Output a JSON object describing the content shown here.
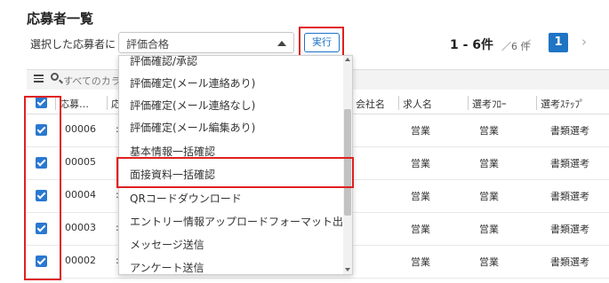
{
  "page": {
    "title": "応募者一覧"
  },
  "action_bar": {
    "label": "選択した応募者に",
    "selected_action": "評価合格",
    "run_label": "実行"
  },
  "pager": {
    "count": "1 - 6件",
    "total": "／6 件",
    "prev": "‹",
    "current_page": "1",
    "next": "›"
  },
  "toolbar": {
    "search_placeholder": "すべてのカラ"
  },
  "table": {
    "headers": [
      "応募…",
      "応",
      "会社名",
      "求人名",
      "選考ﾌﾛｰ",
      "選考ｽﾃｯﾌﾟ"
    ],
    "rows": [
      {
        "id": "00006",
        "job": "営業",
        "flow": "営業",
        "step": "書類選考"
      },
      {
        "id": "00005",
        "job": "営業",
        "flow": "営業",
        "step": "書類選考"
      },
      {
        "id": "00004",
        "job": "営業",
        "flow": "営業",
        "step": "書類選考"
      },
      {
        "id": "00003",
        "job": "営業",
        "flow": "営業",
        "step": "書類選考"
      },
      {
        "id": "00002",
        "job": "営業",
        "flow": "営業",
        "step": "書類選考"
      }
    ]
  },
  "dropdown": {
    "options": [
      "評価確認/承認",
      "評価確定(メール連絡あり)",
      "評価確定(メール連絡なし)",
      "評価確定(メール編集あり)",
      "基本情報一括確認",
      "面接資料一括確認",
      "QRコードダウンロード",
      "エントリー情報アップロードフォーマット出力",
      "メッセージ送信",
      "アンケート送信"
    ]
  },
  "colors": {
    "accent": "#1f74c4",
    "highlight": "#e02020"
  }
}
